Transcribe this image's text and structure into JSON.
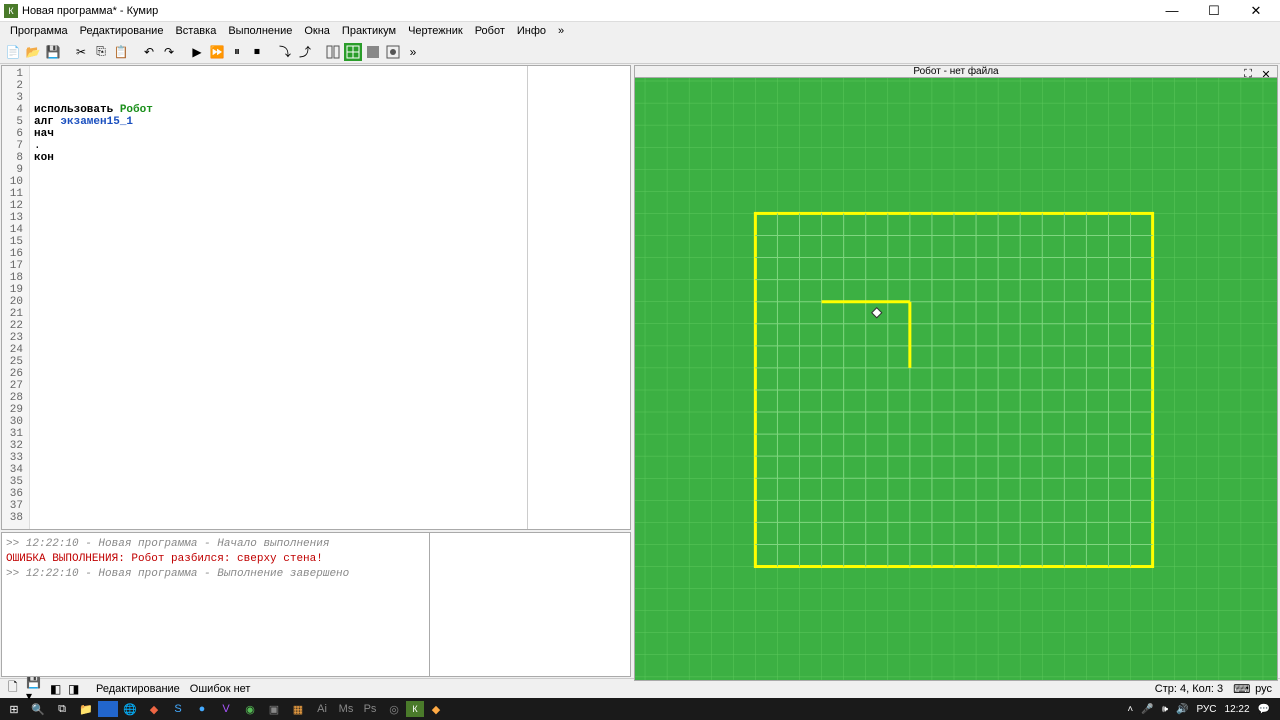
{
  "window": {
    "title": "Новая программа* - Кумир",
    "icon_letter": "К"
  },
  "menu": [
    "Программа",
    "Редактирование",
    "Вставка",
    "Выполнение",
    "Окна",
    "Практикум",
    "Чертежник",
    "Робот",
    "Инфо",
    "»"
  ],
  "editor": {
    "lines": [
      {
        "n": 1,
        "parts": [
          {
            "t": "использовать ",
            "c": "kw"
          },
          {
            "t": "Робот",
            "c": "mod"
          }
        ]
      },
      {
        "n": 2,
        "parts": [
          {
            "t": "алг ",
            "c": "kw"
          },
          {
            "t": "экзамен15_1",
            "c": "nm"
          }
        ]
      },
      {
        "n": 3,
        "parts": [
          {
            "t": "нач",
            "c": "kw"
          }
        ]
      },
      {
        "n": 4,
        "parts": [
          {
            "t": ".",
            "c": ""
          }
        ]
      },
      {
        "n": 5,
        "parts": [
          {
            "t": "кон",
            "c": "kw"
          }
        ]
      }
    ],
    "total_lines": 38
  },
  "console": {
    "lines": [
      {
        "text": ">> 12:22:10 - Новая программа - Начало выполнения",
        "cls": "log"
      },
      {
        "text": "ОШИБКА ВЫПОЛНЕНИЯ: Робот разбился: сверху стена!",
        "cls": "err"
      },
      {
        "text": ">> 12:22:10 - Новая программа - Выполнение завершено",
        "cls": "log"
      }
    ]
  },
  "robot": {
    "title": "Робот - нет файла",
    "grid": {
      "cols": 18,
      "rows": 16,
      "cell": 22
    },
    "robot_cell": {
      "col": 5,
      "row": 4
    },
    "walls": [
      {
        "from_col": 3,
        "from_row": 4,
        "to_col": 7,
        "to_row": 4
      },
      {
        "from_col": 7,
        "from_row": 4,
        "to_col": 7,
        "to_row": 7
      }
    ]
  },
  "status": {
    "mode": "Редактирование",
    "errors": "Ошибок нет",
    "pos": "Стр: 4, Кол: 3",
    "lang": "рус"
  },
  "tray": {
    "lang": "РУС",
    "time": "12:22"
  }
}
